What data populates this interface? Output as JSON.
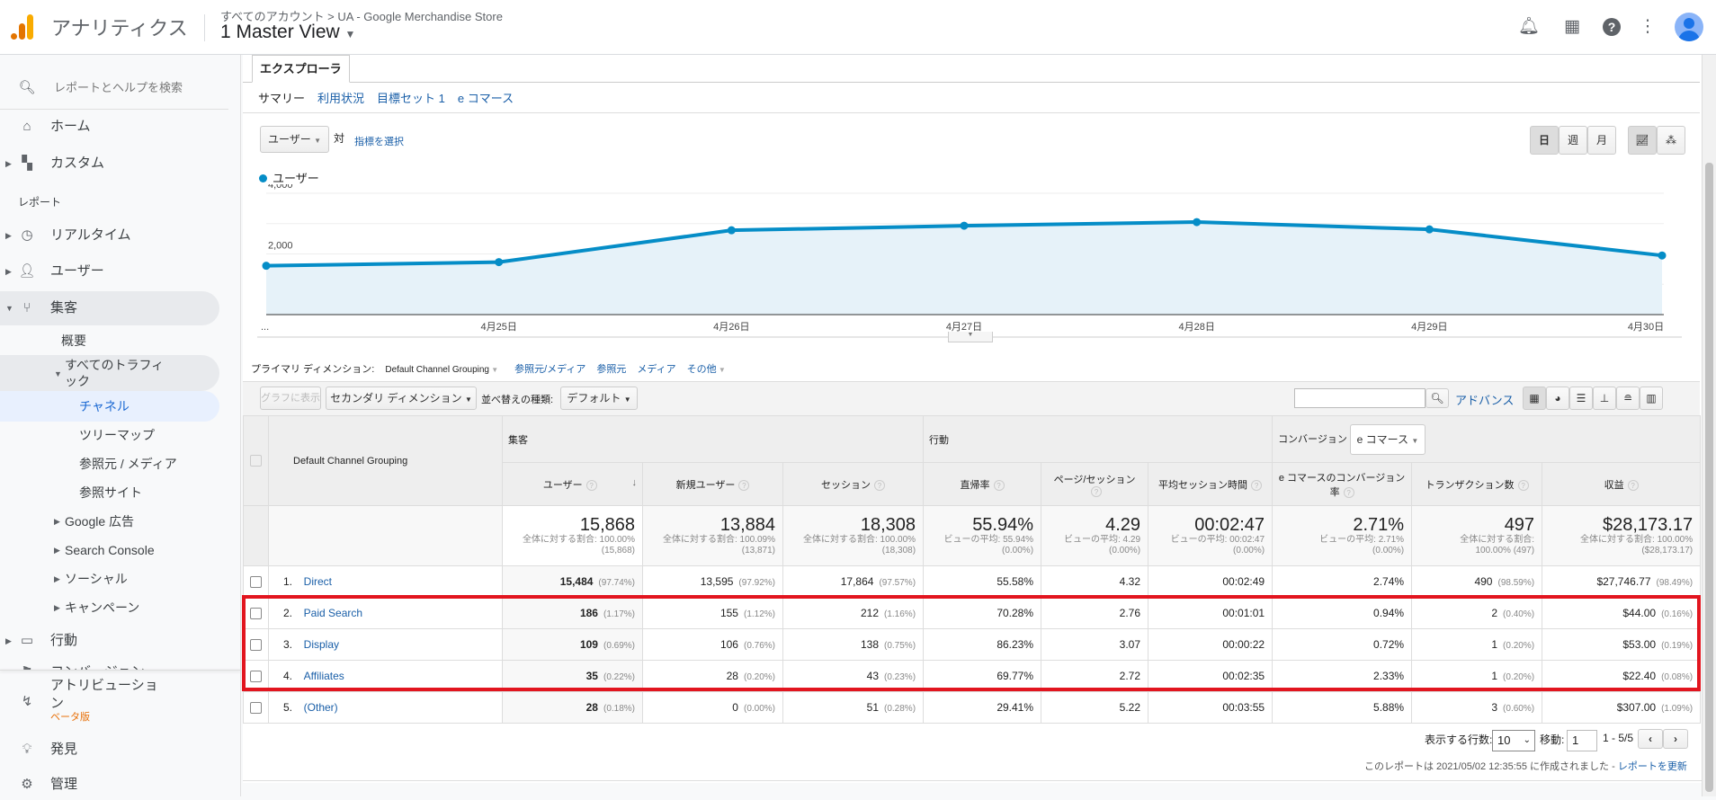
{
  "header": {
    "app_name": "アナリティクス",
    "breadcrumb": "すべてのアカウント > UA - Google Merchandise Store",
    "view": "1 Master View",
    "icons": [
      "bell-icon",
      "apps-icon",
      "help-icon",
      "more-vert-icon",
      "avatar"
    ]
  },
  "sidebar": {
    "search_placeholder": "レポートとヘルプを検索",
    "home": "ホーム",
    "custom": "カスタム",
    "reports_label": "レポート",
    "realtime": "リアルタイム",
    "audience": "ユーザー",
    "acquisition": "集客",
    "overview": "概要",
    "all_traffic": "すべてのトラフィック",
    "channels": "チャネル",
    "treemaps": "ツリーマップ",
    "source_medium": "参照元 / メディア",
    "referrals": "参照サイト",
    "google_ads": "Google 広告",
    "search_console": "Search Console",
    "social": "ソーシャル",
    "campaigns": "キャンペーン",
    "behavior": "行動",
    "conversions": "コンバージョン",
    "attribution": "アトリビューション",
    "beta": "ベータ版",
    "discover": "発見",
    "admin": "管理"
  },
  "explorer": {
    "tab": "エクスプローラ",
    "subtabs": [
      "サマリー",
      "利用状況",
      "目標セット 1",
      "e コマース"
    ],
    "metric_select": "ユーザー",
    "vs": "対",
    "select_metric": "指標を選択",
    "period": [
      "日",
      "週",
      "月"
    ]
  },
  "chart_data": {
    "type": "area",
    "series": [
      {
        "name": "ユーザー",
        "values": [
          1610,
          1730,
          2780,
          2930,
          3050,
          2810,
          1950
        ]
      }
    ],
    "x": [
      "...",
      "4月25日",
      "4月26日",
      "4月27日",
      "4月28日",
      "4月29日",
      "4月30日"
    ],
    "yticks": [
      "4,000",
      "2,000"
    ],
    "ylim": [
      0,
      4000
    ],
    "grid": true,
    "color": "#058dc7"
  },
  "dimension": {
    "label": "プライマリ ディメンション:",
    "current": "Default Channel Grouping",
    "options": [
      "参照元/メディア",
      "参照元",
      "メディア",
      "その他"
    ]
  },
  "toolbar": {
    "plot_rows": "グラフに表示",
    "secondary": "セカンダリ ディメンション",
    "sort_label": "並べ替えの種類:",
    "sort_value": "デフォルト",
    "advanced": "アドバンス"
  },
  "table": {
    "dim_header": "Default Channel Grouping",
    "groups": {
      "acquisition": "集客",
      "behavior": "行動",
      "conversions": "コンバージョン",
      "conv_select": "e コマース"
    },
    "columns": [
      "ユーザー",
      "新規ユーザー",
      "セッション",
      "直帰率",
      "ページ/セッション",
      "平均セッション時間",
      "e コマースのコンバージョン率",
      "トランザクション数",
      "収益"
    ],
    "summary": [
      {
        "v": "15,868",
        "s1": "全体に対する割合: 100.00%",
        "s2": "(15,868)"
      },
      {
        "v": "13,884",
        "s1": "全体に対する割合: 100.09%",
        "s2": "(13,871)"
      },
      {
        "v": "18,308",
        "s1": "全体に対する割合: 100.00%",
        "s2": "(18,308)"
      },
      {
        "v": "55.94%",
        "s1": "ビューの平均: 55.94%",
        "s2": "(0.00%)"
      },
      {
        "v": "4.29",
        "s1": "ビューの平均: 4.29",
        "s2": "(0.00%)"
      },
      {
        "v": "00:02:47",
        "s1": "ビューの平均: 00:02:47",
        "s2": "(0.00%)"
      },
      {
        "v": "2.71%",
        "s1": "ビューの平均: 2.71%",
        "s2": "(0.00%)"
      },
      {
        "v": "497",
        "s1": "全体に対する割合:",
        "s2": "100.00% (497)"
      },
      {
        "v": "$28,173.17",
        "s1": "全体に対する割合: 100.00%",
        "s2": "($28,173.17)"
      }
    ],
    "rows": [
      {
        "n": "1.",
        "name": "Direct",
        "c": [
          [
            "15,484",
            "(97.74%)"
          ],
          [
            "13,595",
            "(97.92%)"
          ],
          [
            "17,864",
            "(97.57%)"
          ],
          [
            "55.58%"
          ],
          [
            "4.32"
          ],
          [
            "00:02:49"
          ],
          [
            "2.74%"
          ],
          [
            "490",
            "(98.59%)"
          ],
          [
            "$27,746.77",
            "(98.49%)"
          ]
        ]
      },
      {
        "n": "2.",
        "name": "Paid Search",
        "c": [
          [
            "186",
            "(1.17%)"
          ],
          [
            "155",
            "(1.12%)"
          ],
          [
            "212",
            "(1.16%)"
          ],
          [
            "70.28%"
          ],
          [
            "2.76"
          ],
          [
            "00:01:01"
          ],
          [
            "0.94%"
          ],
          [
            "2",
            "(0.40%)"
          ],
          [
            "$44.00",
            "(0.16%)"
          ]
        ]
      },
      {
        "n": "3.",
        "name": "Display",
        "c": [
          [
            "109",
            "(0.69%)"
          ],
          [
            "106",
            "(0.76%)"
          ],
          [
            "138",
            "(0.75%)"
          ],
          [
            "86.23%"
          ],
          [
            "3.07"
          ],
          [
            "00:00:22"
          ],
          [
            "0.72%"
          ],
          [
            "1",
            "(0.20%)"
          ],
          [
            "$53.00",
            "(0.19%)"
          ]
        ]
      },
      {
        "n": "4.",
        "name": "Affiliates",
        "c": [
          [
            "35",
            "(0.22%)"
          ],
          [
            "28",
            "(0.20%)"
          ],
          [
            "43",
            "(0.23%)"
          ],
          [
            "69.77%"
          ],
          [
            "2.72"
          ],
          [
            "00:02:35"
          ],
          [
            "2.33%"
          ],
          [
            "1",
            "(0.20%)"
          ],
          [
            "$22.40",
            "(0.08%)"
          ]
        ]
      },
      {
        "n": "5.",
        "name": "(Other)",
        "c": [
          [
            "28",
            "(0.18%)"
          ],
          [
            "0",
            "(0.00%)"
          ],
          [
            "51",
            "(0.28%)"
          ],
          [
            "29.41%"
          ],
          [
            "5.22"
          ],
          [
            "00:03:55"
          ],
          [
            "5.88%"
          ],
          [
            "3",
            "(0.60%)"
          ],
          [
            "$307.00",
            "(1.09%)"
          ]
        ]
      }
    ]
  },
  "pagination": {
    "rows_label": "表示する行数:",
    "rows_value": "10",
    "goto_label": "移動:",
    "goto_value": "1",
    "range": "1 - 5/5"
  },
  "footer": {
    "text": "このレポートは 2021/05/02 12:35:55 に作成されました - ",
    "refresh": "レポートを更新"
  },
  "highlight_color": "#e2151f"
}
